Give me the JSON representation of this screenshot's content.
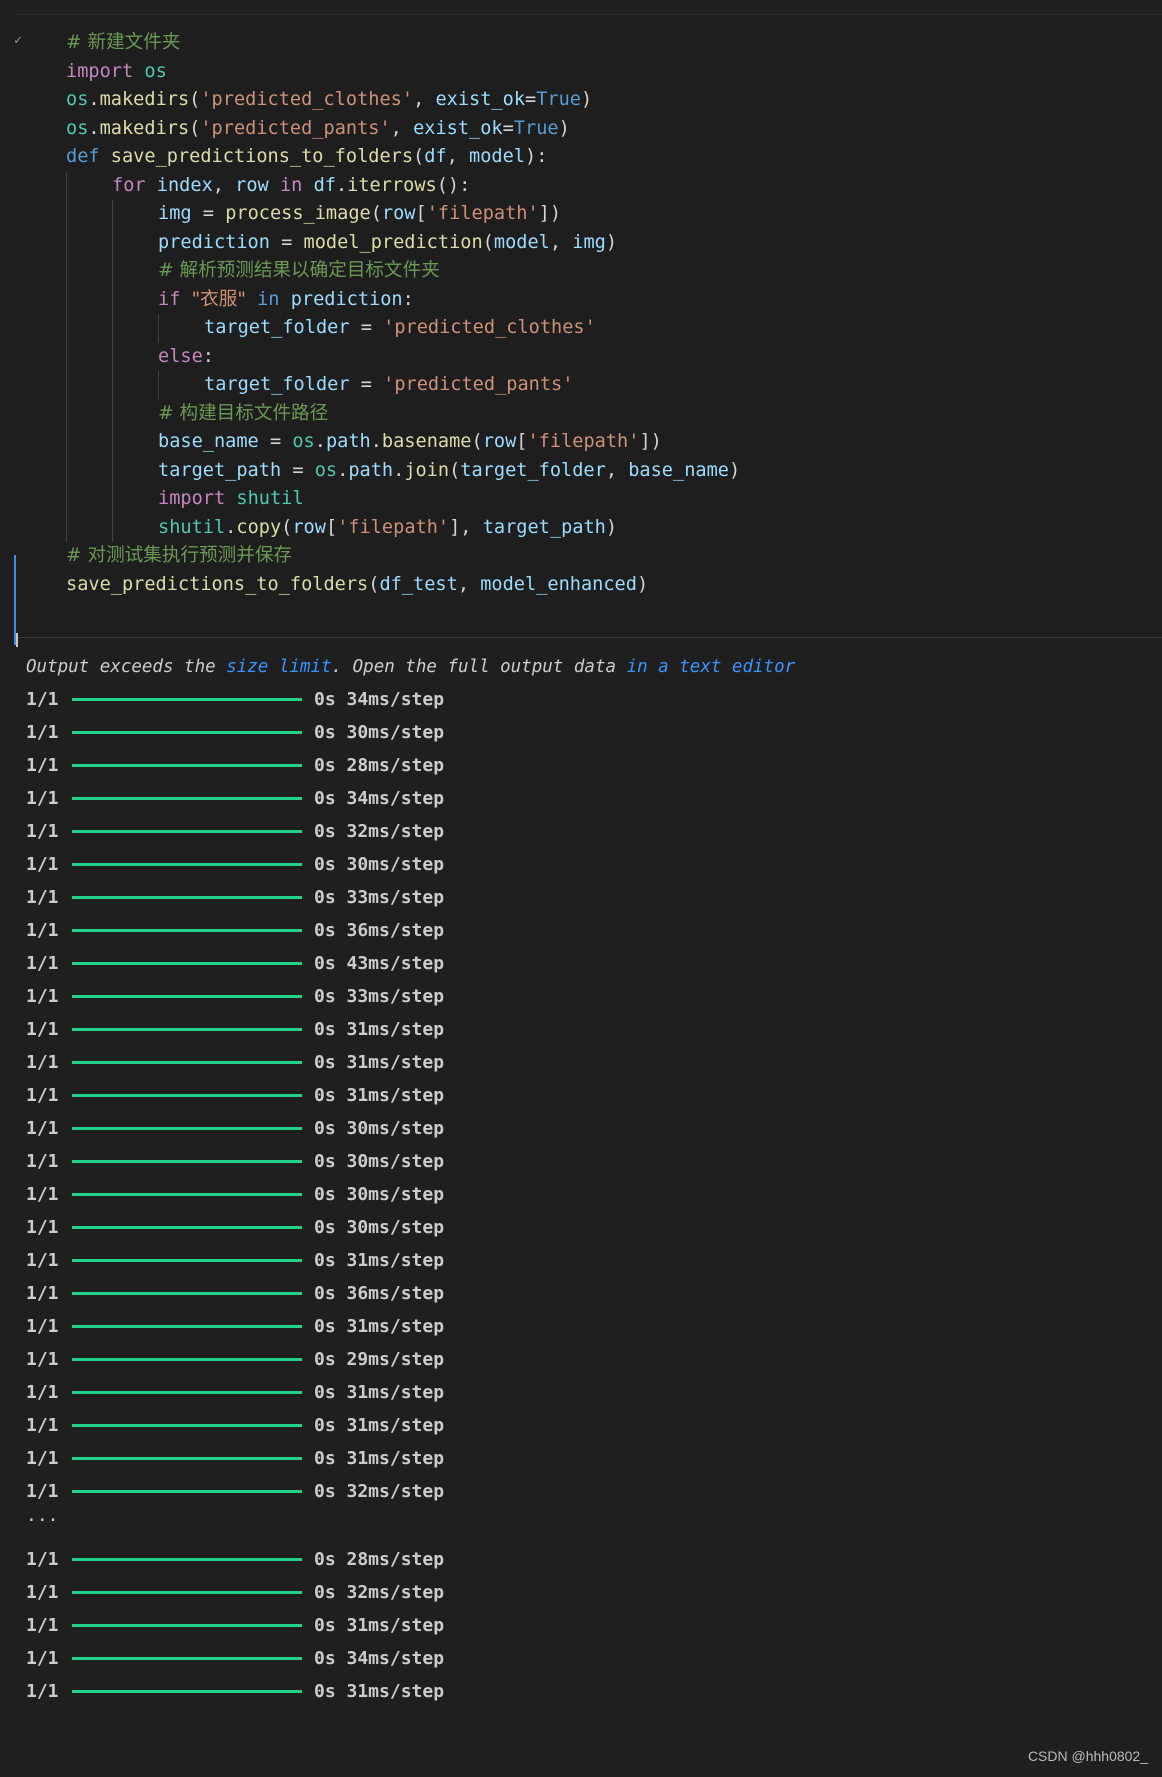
{
  "cell": {
    "status_glyph": "✓",
    "code_lines": [
      {
        "indent": 0,
        "tokens": [
          {
            "c": "cm",
            "t": "# 新建文件夹"
          }
        ]
      },
      {
        "indent": 0,
        "tokens": [
          {
            "c": "kw",
            "t": "import"
          },
          {
            "c": "pn",
            "t": " "
          },
          {
            "c": "md",
            "t": "os"
          }
        ]
      },
      {
        "indent": 0,
        "tokens": [
          {
            "c": "md",
            "t": "os"
          },
          {
            "c": "pn",
            "t": "."
          },
          {
            "c": "fn",
            "t": "makedirs"
          },
          {
            "c": "pn",
            "t": "("
          },
          {
            "c": "st",
            "t": "'predicted_clothes'"
          },
          {
            "c": "pn",
            "t": ", "
          },
          {
            "c": "vr",
            "t": "exist_ok"
          },
          {
            "c": "pn",
            "t": "="
          },
          {
            "c": "tr",
            "t": "True"
          },
          {
            "c": "pn",
            "t": ")"
          }
        ]
      },
      {
        "indent": 0,
        "tokens": [
          {
            "c": "md",
            "t": "os"
          },
          {
            "c": "pn",
            "t": "."
          },
          {
            "c": "fn",
            "t": "makedirs"
          },
          {
            "c": "pn",
            "t": "("
          },
          {
            "c": "st",
            "t": "'predicted_pants'"
          },
          {
            "c": "pn",
            "t": ", "
          },
          {
            "c": "vr",
            "t": "exist_ok"
          },
          {
            "c": "pn",
            "t": "="
          },
          {
            "c": "tr",
            "t": "True"
          },
          {
            "c": "pn",
            "t": ")"
          }
        ]
      },
      {
        "indent": 0,
        "tokens": [
          {
            "c": "kd",
            "t": "def"
          },
          {
            "c": "pn",
            "t": " "
          },
          {
            "c": "fn",
            "t": "save_predictions_to_folders"
          },
          {
            "c": "pn",
            "t": "("
          },
          {
            "c": "vr",
            "t": "df"
          },
          {
            "c": "pn",
            "t": ", "
          },
          {
            "c": "vr",
            "t": "model"
          },
          {
            "c": "pn",
            "t": "):"
          }
        ]
      },
      {
        "indent": 1,
        "tokens": [
          {
            "c": "kw",
            "t": "for"
          },
          {
            "c": "pn",
            "t": " "
          },
          {
            "c": "vr",
            "t": "index"
          },
          {
            "c": "pn",
            "t": ", "
          },
          {
            "c": "vr",
            "t": "row"
          },
          {
            "c": "pn",
            "t": " "
          },
          {
            "c": "kw",
            "t": "in"
          },
          {
            "c": "pn",
            "t": " "
          },
          {
            "c": "vr",
            "t": "df"
          },
          {
            "c": "pn",
            "t": "."
          },
          {
            "c": "fn",
            "t": "iterrows"
          },
          {
            "c": "pn",
            "t": "():"
          }
        ]
      },
      {
        "indent": 2,
        "tokens": [
          {
            "c": "vr",
            "t": "img"
          },
          {
            "c": "pn",
            "t": " = "
          },
          {
            "c": "fn",
            "t": "process_image"
          },
          {
            "c": "pn",
            "t": "("
          },
          {
            "c": "vr",
            "t": "row"
          },
          {
            "c": "pn",
            "t": "["
          },
          {
            "c": "st",
            "t": "'filepath'"
          },
          {
            "c": "pn",
            "t": "])"
          }
        ]
      },
      {
        "indent": 2,
        "tokens": [
          {
            "c": "vr",
            "t": "prediction"
          },
          {
            "c": "pn",
            "t": " = "
          },
          {
            "c": "fn",
            "t": "model_prediction"
          },
          {
            "c": "pn",
            "t": "("
          },
          {
            "c": "vr",
            "t": "model"
          },
          {
            "c": "pn",
            "t": ", "
          },
          {
            "c": "vr",
            "t": "img"
          },
          {
            "c": "pn",
            "t": ")"
          }
        ]
      },
      {
        "indent": 2,
        "tokens": [
          {
            "c": "cm",
            "t": "# 解析预测结果以确定目标文件夹"
          }
        ]
      },
      {
        "indent": 2,
        "tokens": [
          {
            "c": "kw",
            "t": "if"
          },
          {
            "c": "pn",
            "t": " "
          },
          {
            "c": "st",
            "t": "\"衣服\""
          },
          {
            "c": "pn",
            "t": " "
          },
          {
            "c": "kd",
            "t": "in"
          },
          {
            "c": "pn",
            "t": " "
          },
          {
            "c": "vr",
            "t": "prediction"
          },
          {
            "c": "pn",
            "t": ":"
          }
        ]
      },
      {
        "indent": 3,
        "tokens": [
          {
            "c": "vr",
            "t": "target_folder"
          },
          {
            "c": "pn",
            "t": " = "
          },
          {
            "c": "st",
            "t": "'predicted_clothes'"
          }
        ]
      },
      {
        "indent": 2,
        "tokens": [
          {
            "c": "kw",
            "t": "else"
          },
          {
            "c": "pn",
            "t": ":"
          }
        ]
      },
      {
        "indent": 3,
        "tokens": [
          {
            "c": "vr",
            "t": "target_folder"
          },
          {
            "c": "pn",
            "t": " = "
          },
          {
            "c": "st",
            "t": "'predicted_pants'"
          }
        ]
      },
      {
        "indent": 2,
        "tokens": [
          {
            "c": "cm",
            "t": "# 构建目标文件路径"
          }
        ]
      },
      {
        "indent": 2,
        "tokens": [
          {
            "c": "vr",
            "t": "base_name"
          },
          {
            "c": "pn",
            "t": " = "
          },
          {
            "c": "md",
            "t": "os"
          },
          {
            "c": "pn",
            "t": "."
          },
          {
            "c": "vr",
            "t": "path"
          },
          {
            "c": "pn",
            "t": "."
          },
          {
            "c": "fn",
            "t": "basename"
          },
          {
            "c": "pn",
            "t": "("
          },
          {
            "c": "vr",
            "t": "row"
          },
          {
            "c": "pn",
            "t": "["
          },
          {
            "c": "st",
            "t": "'filepath'"
          },
          {
            "c": "pn",
            "t": "])"
          }
        ]
      },
      {
        "indent": 2,
        "tokens": [
          {
            "c": "vr",
            "t": "target_path"
          },
          {
            "c": "pn",
            "t": " = "
          },
          {
            "c": "md",
            "t": "os"
          },
          {
            "c": "pn",
            "t": "."
          },
          {
            "c": "vr",
            "t": "path"
          },
          {
            "c": "pn",
            "t": "."
          },
          {
            "c": "fn",
            "t": "join"
          },
          {
            "c": "pn",
            "t": "("
          },
          {
            "c": "vr",
            "t": "target_folder"
          },
          {
            "c": "pn",
            "t": ", "
          },
          {
            "c": "vr",
            "t": "base_name"
          },
          {
            "c": "pn",
            "t": ")"
          }
        ]
      },
      {
        "indent": 2,
        "tokens": [
          {
            "c": "kw",
            "t": "import"
          },
          {
            "c": "pn",
            "t": " "
          },
          {
            "c": "md",
            "t": "shutil"
          }
        ]
      },
      {
        "indent": 2,
        "tokens": [
          {
            "c": "md",
            "t": "shutil"
          },
          {
            "c": "pn",
            "t": "."
          },
          {
            "c": "fn",
            "t": "copy"
          },
          {
            "c": "pn",
            "t": "("
          },
          {
            "c": "vr",
            "t": "row"
          },
          {
            "c": "pn",
            "t": "["
          },
          {
            "c": "st",
            "t": "'filepath'"
          },
          {
            "c": "pn",
            "t": "], "
          },
          {
            "c": "vr",
            "t": "target_path"
          },
          {
            "c": "pn",
            "t": ")"
          }
        ]
      },
      {
        "indent": 0,
        "tokens": [
          {
            "c": "cm",
            "t": "# 对测试集执行预测并保存"
          }
        ]
      },
      {
        "indent": 0,
        "tokens": [
          {
            "c": "fn",
            "t": "save_predictions_to_folders"
          },
          {
            "c": "pn",
            "t": "("
          },
          {
            "c": "vr",
            "t": "df_test"
          },
          {
            "c": "pn",
            "t": ", "
          },
          {
            "c": "vr",
            "t": "model_enhanced"
          },
          {
            "c": "pn",
            "t": ")"
          }
        ]
      }
    ]
  },
  "output": {
    "limit_prefix": "Output exceeds the ",
    "size_limit_link": "size limit",
    "limit_middle": ". Open the full output data ",
    "text_editor_link": "in a text editor",
    "progress_fraction": "1/1",
    "progress_level": 1.0,
    "rows_first": [
      "0s 34ms/step",
      "0s 30ms/step",
      "0s 28ms/step",
      "0s 34ms/step",
      "0s 32ms/step",
      "0s 30ms/step",
      "0s 33ms/step",
      "0s 36ms/step",
      "0s 43ms/step",
      "0s 33ms/step",
      "0s 31ms/step",
      "0s 31ms/step",
      "0s 31ms/step",
      "0s 30ms/step",
      "0s 30ms/step",
      "0s 30ms/step",
      "0s 30ms/step",
      "0s 31ms/step",
      "0s 36ms/step",
      "0s 31ms/step",
      "0s 29ms/step",
      "0s 31ms/step",
      "0s 31ms/step",
      "0s 31ms/step",
      "0s 32ms/step"
    ],
    "ellipsis": "...",
    "rows_last": [
      "0s 28ms/step",
      "0s 32ms/step",
      "0s 31ms/step",
      "0s 34ms/step",
      "0s 31ms/step"
    ],
    "bar_color": "#23d18b"
  },
  "watermark": "CSDN @hhh0802_"
}
